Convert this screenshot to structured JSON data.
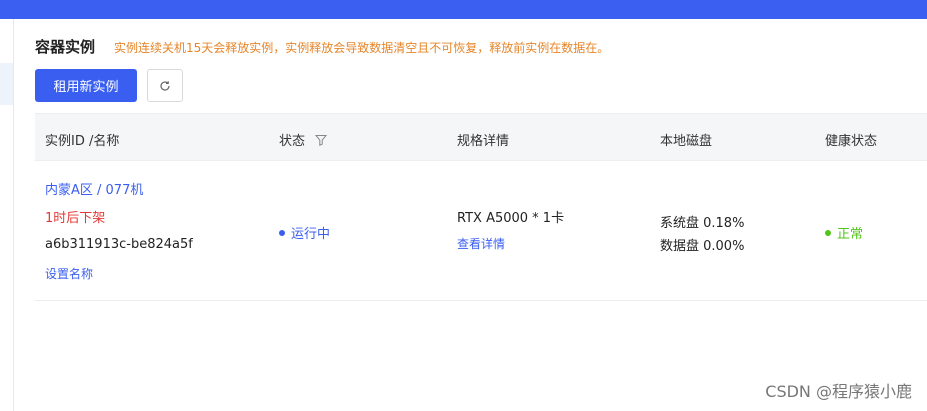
{
  "page": {
    "title": "容器实例",
    "notice": "实例连续关机15天会释放实例，实例释放会导致数据清空且不可恢复，释放前实例在数据在。"
  },
  "toolbar": {
    "rent_button": "租用新实例",
    "refresh_icon": "refresh-icon"
  },
  "table": {
    "columns": [
      "实例ID /名称",
      "状态",
      "规格详情",
      "本地磁盘",
      "健康状态"
    ],
    "filter_icon": "filter-icon",
    "rows": [
      {
        "region": "内蒙A区 / 077机",
        "offline_notice": "1时后下架",
        "instance_id": "a6b311913c-be824a5f",
        "set_name": "设置名称",
        "status": "运行中",
        "spec": "RTX A5000 * 1卡",
        "spec_detail_link": "查看详情",
        "disk_system": "系统盘 0.18%",
        "disk_data": "数据盘 0.00%",
        "health": "正常"
      }
    ]
  },
  "colors": {
    "accent": "#3a5ef0",
    "topbar": "#3b5ff0",
    "warning": "#e6862b",
    "danger": "#e53935",
    "success": "#52c41a"
  },
  "watermark": "CSDN @程序猿小鹿"
}
